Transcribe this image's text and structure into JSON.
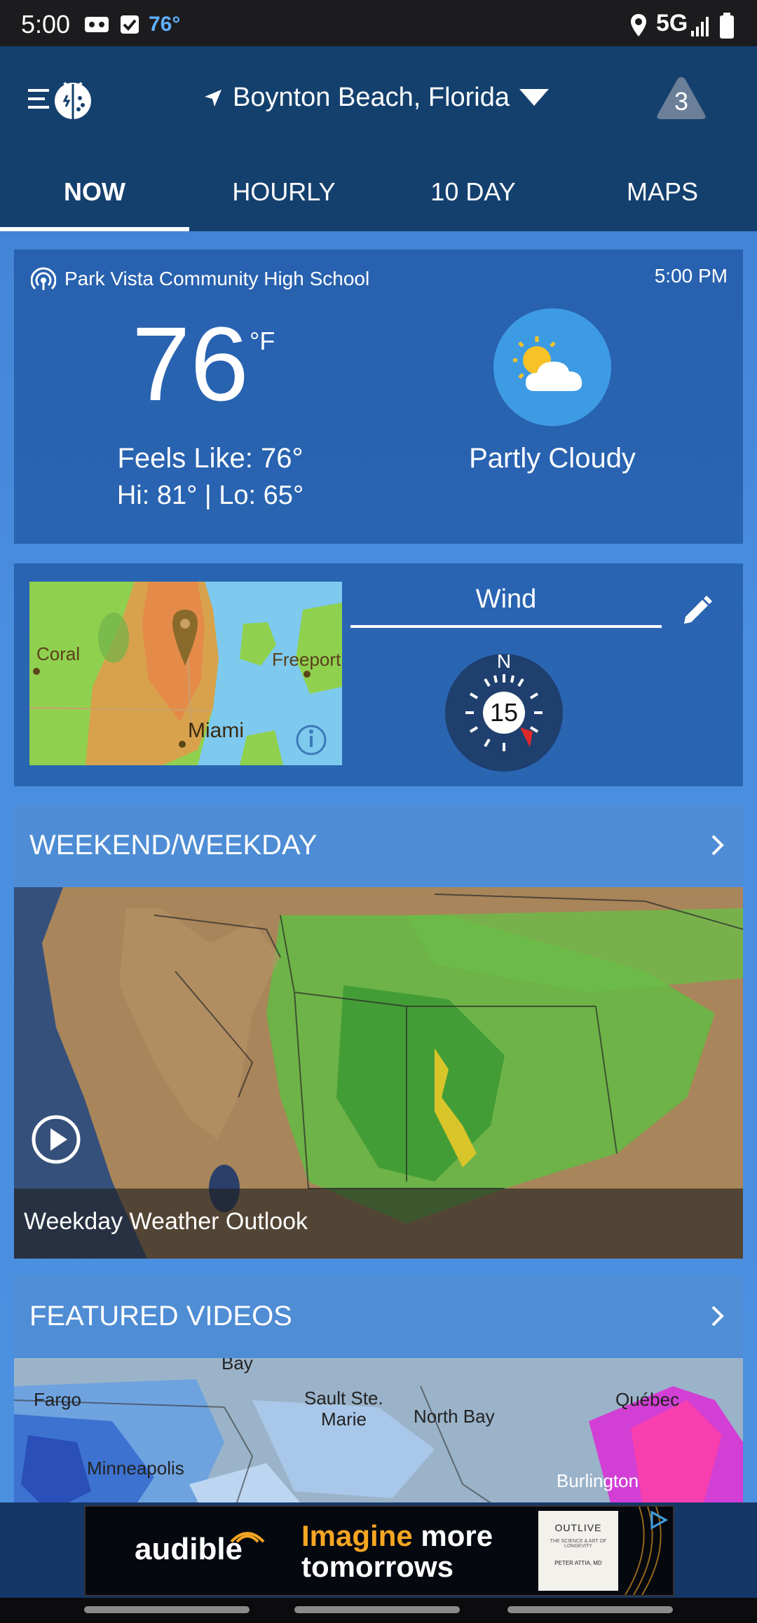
{
  "status_bar": {
    "time": "5:00",
    "temp": "76°",
    "network": "5G"
  },
  "header": {
    "location": "Boynton Beach, Florida",
    "alert_count": "3"
  },
  "tabs": [
    {
      "label": "NOW",
      "active": true
    },
    {
      "label": "HOURLY",
      "active": false
    },
    {
      "label": "10 DAY",
      "active": false
    },
    {
      "label": "MAPS",
      "active": false
    }
  ],
  "now": {
    "station": "Park Vista Community High School",
    "obs_time": "5:00 PM",
    "temp": "76",
    "unit": "°F",
    "feels_like": "Feels Like: 76°",
    "hi_lo": "Hi: 81° | Lo: 65°",
    "condition": "Partly Cloudy",
    "condition_icon": "partly-cloudy-icon"
  },
  "wind": {
    "label": "Wind",
    "speed": "15",
    "north": "N",
    "map_labels": {
      "coral": "Coral",
      "freeport": "Freeport",
      "miami": "Miami"
    }
  },
  "weekend": {
    "title": "WEEKEND/WEEKDAY",
    "caption": "Weekday Weather Outlook"
  },
  "featured": {
    "title": "FEATURED VIDEOS",
    "map_labels": [
      "Fargo",
      "Sault Ste.",
      "Marie",
      "North Bay",
      "Québec",
      "Minneapolis",
      "Burlington",
      "Bay"
    ]
  },
  "ad": {
    "brand": "audible",
    "line1_a": "Imagine",
    "line1_b": "more",
    "line2": "tomorrows",
    "book_title": "OUTLIVE",
    "book_sub": "THE SCIENCE & ART OF LONGEVITY",
    "book_author": "PETER ATTIA, MD"
  },
  "colors": {
    "header_bg": "#14406e",
    "accent": "#3d9be4",
    "ad_orange": "#f5a623"
  }
}
